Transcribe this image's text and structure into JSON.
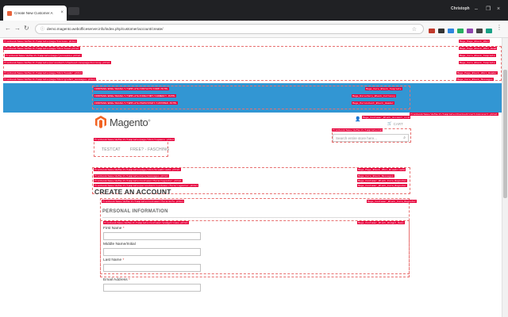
{
  "browser": {
    "tab_title": "Create New Customer A",
    "tab_close": "×",
    "user": "Christoph",
    "url": "demo.magento.webofficeserver.info/index.php/customer/account/create/",
    "controls": {
      "minimize": "–",
      "maximize": "❐",
      "close": "×"
    },
    "nav": {
      "back": "←",
      "forward": "→",
      "reload": "↻"
    }
  },
  "hints": {
    "top": [
      "frontend/base/default/template/page/1column.phtml",
      "frontend/base/default/template/page/html/head.phtml",
      "frontend/base/default/template/page/js/cookie.phtml",
      "frontend/base/default/template/persistent/checkout/onepage/billing.phtml",
      "frontend/base/default/template/page/html/header.phtml",
      "frontend/base/default/template/page/html/global_messages.phtml"
    ],
    "top_right": [
      "Mage_Page_Block_Html",
      "Mage_Page_Block_Html_Head",
      "Mage_Core_Block_Template",
      "Mage_Core_Block_Template",
      "Mage_Page_Block_Html_Header",
      "Mage_Core_Block_Messages"
    ],
    "blue": [
      "FRONTEND/BASE/DEFAULT/TEMPLATE/CONTACTS/FORM.PHTML",
      "FRONTEND/BASE/DEFAULT/TEMPLATE/DIRECTORY/CURRENCY.PHTML",
      "FRONTEND/BASE/DEFAULT/TEMPLATE/PERSISTENT/CUSTOMER.PHTML"
    ],
    "blue_right": [
      "Mage_Core_Block_Template",
      "Mage_Directory_Block_Currency",
      "Mage_Persistent_Block_Header"
    ],
    "account_right": "Mage_Customer_Block_Account_Link",
    "cart_hint": "frontend/base/default/template/checkout/cart/minicart.phtml",
    "nav_hint": "frontend/base/default/template/page/html/topmenu.phtml",
    "form": [
      "frontend/base/default/template/page/html/breadcrumbs.phtml",
      "frontend/base/default/template/core/messages.phtml",
      "frontend/base/default/template/customer/form/register.phtml",
      "frontend/base/default/template/persistent/customer/form/register.phtml"
    ],
    "form_right": [
      "Mage_Page_Block_Html_Breadcrumbs",
      "Mage_Core_Block_Messages",
      "Mage_Customer_Block_Form_Register",
      "Mage_Customer_Block_Form_Register"
    ],
    "info": "frontend/base/default/template/customer/form/info.phtml",
    "info_right": "Mage_Customer_Block_Form_Register",
    "name": "frontend/base/default/template/customer/widget/name.phtml",
    "name_right": "Mage_Customer_Block_Widget_Name"
  },
  "site": {
    "logo": "Magento",
    "cart_label": "CART",
    "search_placeholder": "Search entire store here...",
    "nav": [
      "TESTCAT",
      "FREE? - FASCHING"
    ]
  },
  "form": {
    "title": "CREATE AN ACCOUNT",
    "section": "PERSONAL INFORMATION",
    "fields": [
      {
        "label": "First Name",
        "required": "*"
      },
      {
        "label": "Middle Name/Initial",
        "required": ""
      },
      {
        "label": "Last Name",
        "required": "*"
      },
      {
        "label": "Email Address",
        "required": "*"
      }
    ]
  },
  "colors": {
    "header_blue": "#3296d3",
    "hint_red": "#e6003a",
    "brand_orange": "#f26322"
  }
}
